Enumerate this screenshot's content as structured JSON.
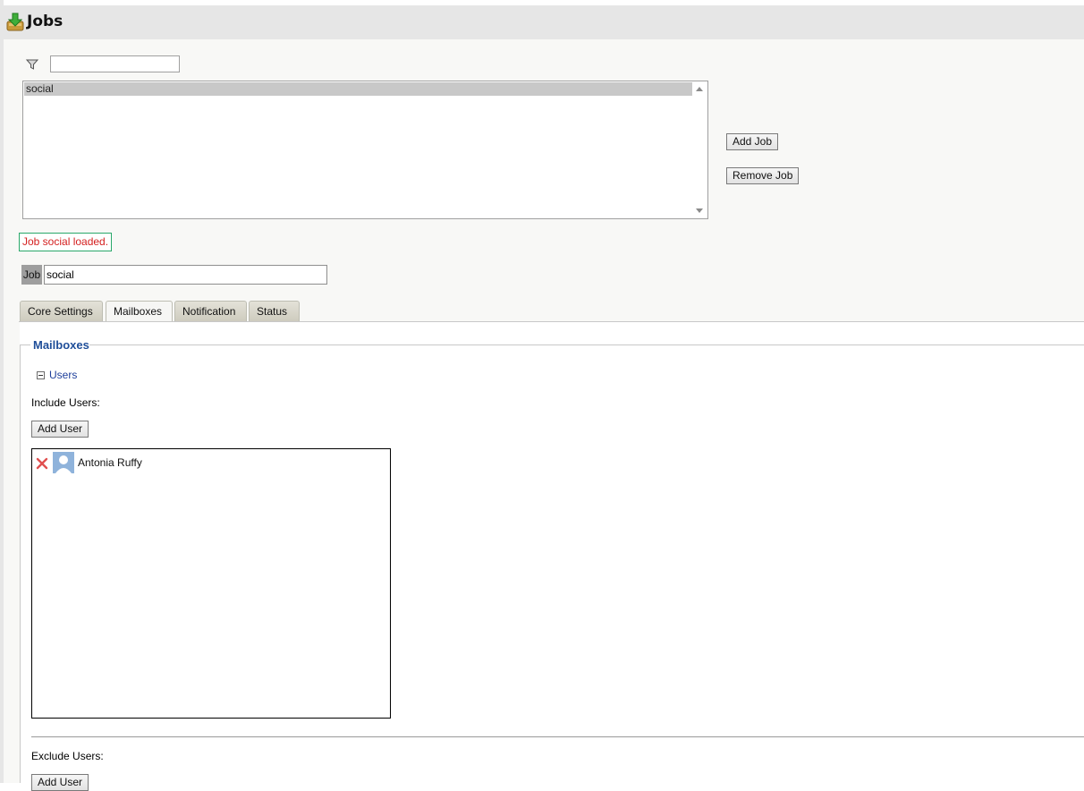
{
  "header": {
    "title": "Jobs",
    "icon": "download-package-icon"
  },
  "filter": {
    "value": "",
    "icon": "funnel-icon"
  },
  "job_list": {
    "items": [
      "social"
    ],
    "selected": "social"
  },
  "buttons": {
    "add_job": "Add Job",
    "remove_job": "Remove Job"
  },
  "status_message": "Job social loaded.",
  "job_field": {
    "label": "Job",
    "value": "social"
  },
  "tabs": [
    {
      "label": "Core Settings"
    },
    {
      "label": "Mailboxes",
      "active": true
    },
    {
      "label": "Notification"
    },
    {
      "label": "Status"
    }
  ],
  "mailboxes": {
    "legend": "Mailboxes",
    "users_toggle": "Users",
    "include_label": "Include Users:",
    "add_user_label": "Add User",
    "included_users": [
      {
        "name": "Antonia Ruffy"
      }
    ],
    "exclude_label": "Exclude Users:",
    "add_user_label_2": "Add User"
  },
  "colors": {
    "header_bg": "#e6e6e6",
    "legend_blue": "#1f4e99",
    "status_text": "#d42020",
    "status_border": "#2aa86a"
  }
}
